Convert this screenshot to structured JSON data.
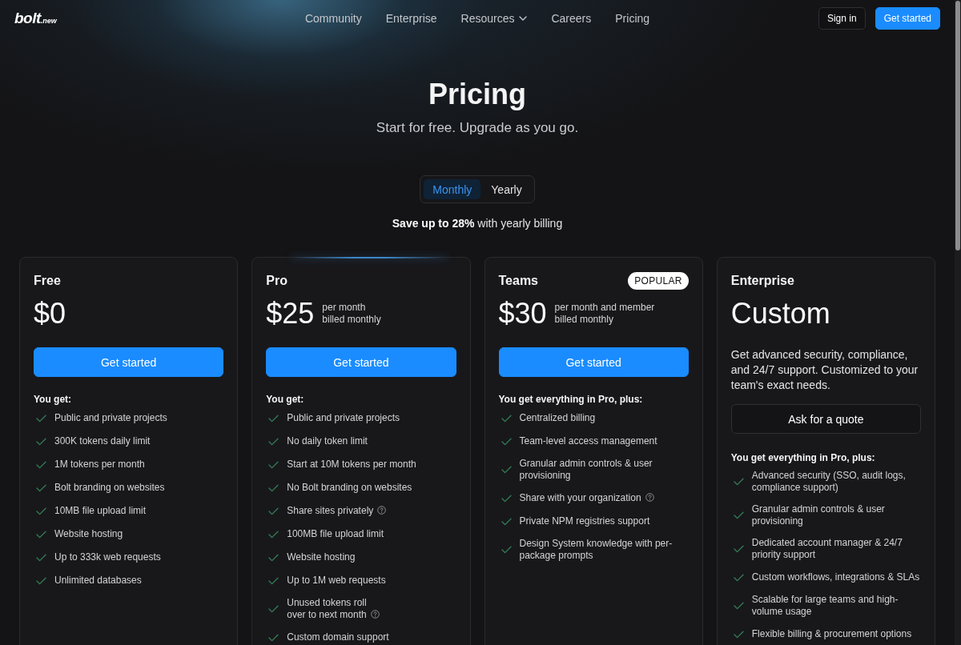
{
  "nav": {
    "logo": {
      "wordmark": "bolt",
      "suffix": ".new"
    },
    "links": [
      {
        "label": "Community",
        "has_menu": false
      },
      {
        "label": "Enterprise",
        "has_menu": false
      },
      {
        "label": "Resources",
        "has_menu": true
      },
      {
        "label": "Careers",
        "has_menu": false
      },
      {
        "label": "Pricing",
        "has_menu": false
      }
    ],
    "actions": [
      {
        "label": "Sign in",
        "kind": "outline"
      },
      {
        "label": "Get started",
        "kind": "primary"
      }
    ]
  },
  "hero": {
    "title": "Pricing",
    "subtitle": "Start for free. Upgrade as you go.",
    "billing_toggle": [
      {
        "label": "Monthly",
        "selected": true
      },
      {
        "label": "Yearly",
        "selected": false
      }
    ],
    "savings_note": "**Save up to 28%** with yearly billing"
  },
  "plans": [
    {
      "name": "Free",
      "featured": false,
      "price": "$0",
      "button": {
        "label": "Get started",
        "kind": "primary"
      },
      "features_heading": "You get:",
      "features": [
        {
          "text": "Public and private projects",
          "help_icon": false
        },
        {
          "text": "300K tokens daily limit",
          "help_icon": false
        },
        {
          "text": "1M tokens per month",
          "help_icon": false
        },
        {
          "text": "Bolt branding on websites",
          "help_icon": false
        },
        {
          "text": "10MB file upload limit",
          "help_icon": false
        },
        {
          "text": "Website hosting",
          "help_icon": false
        },
        {
          "text": "Up to 333k web requests",
          "help_icon": false
        },
        {
          "text": "Unlimited databases",
          "help_icon": false
        }
      ]
    },
    {
      "name": "Pro",
      "featured": true,
      "price": "$25",
      "price_note": [
        "per month",
        "billed monthly"
      ],
      "button": {
        "label": "Get started",
        "kind": "primary"
      },
      "features_heading": "You get:",
      "features": [
        {
          "text": "Public and private projects",
          "help_icon": false
        },
        {
          "text": "No daily token limit",
          "help_icon": false
        },
        {
          "text": "Start at 10M tokens per month",
          "help_icon": false
        },
        {
          "text": "No Bolt branding on websites",
          "help_icon": false
        },
        {
          "text": "Share sites privately",
          "help_icon": true
        },
        {
          "text": "100MB file upload limit",
          "help_icon": false
        },
        {
          "text": "Website hosting",
          "help_icon": false
        },
        {
          "text": "Up to 1M web requests",
          "help_icon": false
        },
        {
          "text": "Unused tokens roll\nover to next month",
          "help_icon": true
        },
        {
          "text": "Custom domain support",
          "help_icon": false
        }
      ]
    },
    {
      "name": "Teams",
      "featured": false,
      "badge": "POPULAR",
      "price": "$30",
      "price_note": [
        "per month and member",
        "billed monthly"
      ],
      "button": {
        "label": "Get started",
        "kind": "primary"
      },
      "features_heading": "You get everything in Pro, plus:",
      "features": [
        {
          "text": "Centralized billing",
          "help_icon": false
        },
        {
          "text": "Team-level access management",
          "help_icon": false
        },
        {
          "text": "Granular admin controls & user provisioning",
          "help_icon": false
        },
        {
          "text": "Share with your organization",
          "help_icon": true
        },
        {
          "text": "Private NPM registries support",
          "help_icon": false
        },
        {
          "text": "Design System knowledge with per-package prompts",
          "help_icon": false
        }
      ]
    },
    {
      "name": "Enterprise",
      "featured": false,
      "price": "Custom",
      "description": "Get advanced security, compliance, and 24/7 support. Customized to your team's exact needs.",
      "button": {
        "label": "Ask for a quote",
        "kind": "outline"
      },
      "features_heading": "You get everything in Pro, plus:",
      "features": [
        {
          "text": "Advanced security (SSO, audit logs, compliance support)",
          "help_icon": false
        },
        {
          "text": "Granular admin controls & user provisioning",
          "help_icon": false
        },
        {
          "text": "Dedicated account manager & 24/7 priority support",
          "help_icon": false
        },
        {
          "text": "Custom workflows, integrations & SLAs",
          "help_icon": false
        },
        {
          "text": "Scalable for large teams and high-volume usage",
          "help_icon": false
        },
        {
          "text": "Flexible billing & procurement options",
          "help_icon": false
        }
      ]
    }
  ]
}
